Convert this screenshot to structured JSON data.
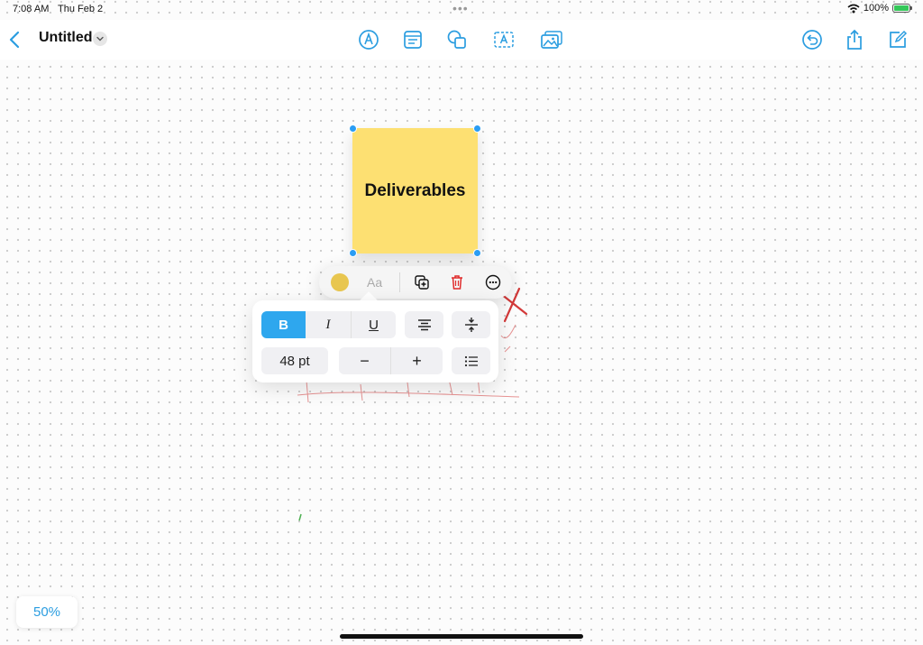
{
  "status_bar": {
    "time": "7:08 AM",
    "date": "Thu Feb 2",
    "battery": "100%"
  },
  "toolbar": {
    "title": "Untitled",
    "icons": [
      "back-chevron-icon",
      "pen-tool-icon",
      "text-box-icon",
      "shapes-icon",
      "text-insert-icon",
      "media-icon",
      "undo-icon",
      "share-icon",
      "compose-icon"
    ]
  },
  "sticky_note": {
    "text": "Deliverables",
    "color": "#fde072"
  },
  "context_menu": {
    "color_swatch": "#e8c64f",
    "font_label": "Aa"
  },
  "format_panel": {
    "bold": "B",
    "italic": "I",
    "underline": "U",
    "font_size": "48 pt",
    "decrease": "−",
    "increase": "+"
  },
  "zoom": {
    "level": "50%"
  },
  "accent_color": "#2ea7ee"
}
